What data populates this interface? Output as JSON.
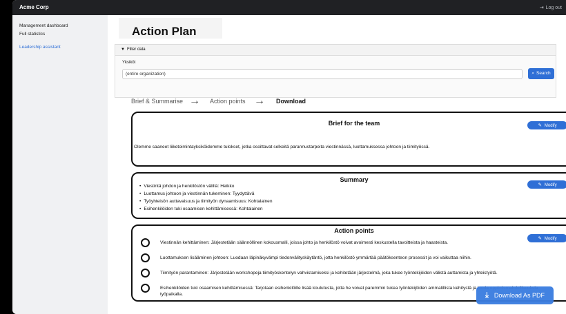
{
  "app": {
    "brand": "Acme Corp",
    "logout_label": "Log out"
  },
  "sidebar": {
    "items": [
      {
        "label": "Management dashboard"
      },
      {
        "label": "Full statistics"
      },
      {
        "label": "Leadership assistant",
        "active": true
      }
    ]
  },
  "page": {
    "title": "Action Plan"
  },
  "filter": {
    "header": "Filter data",
    "field_label": "Yksiköt",
    "value": "(entire organization)",
    "search_label": "Search"
  },
  "steps": [
    {
      "label": "Brief & Summarise"
    },
    {
      "label": "Action points"
    },
    {
      "label": "Download",
      "current": true
    }
  ],
  "brief": {
    "title": "Brief for the team",
    "modify_label": "Modify",
    "text": "Olemme saaneet liiketoimintayksiköidemme tulokset, jotka osoittavat selkeitä parannustarpeita viestinnässä, luottamuksessa johtoon ja tiimityössä."
  },
  "summary": {
    "title": "Summary",
    "modify_label": "Modify",
    "items": [
      "Viestintä johdon ja henkilöstön välillä: Heikko",
      "Luottamus johtoon ja viestinnän tukeminen: Tyydyttävä",
      "Työyhteisön auttavaisuus ja tiimityön dynaamisuus: Kohtalainen",
      "Esihenkilöiden tuki osaamisen kehittämisessä: Kohtalainen"
    ]
  },
  "action_points": {
    "title": "Action points",
    "modify_label": "Modify",
    "items": [
      "Viestinnän kehittäminen: Järjestetään säännöllinen kokousmalli, joissa johto ja henkilöstö voivat avoimesti keskustella tavoitteista ja haasteista.",
      "Luottamuksen lisääminen johtoon: Luodaan läpinäkyvämpi tiedonvälityskäytäntö, jotta henkilöstö ymmärtää päätöksenteon prosessit ja voi vaikuttaa niihin.",
      "Tiimityön parantaminen: Järjestetään workshopeja tiimityöskentelyn vahvistamiseksi ja kehitetään järjestelmä, joka tukee työntekijöiden välistä auttamista ja yhteistyötä.",
      "Esihenkilöiden tuki osaamisen kehittämisessä: Tarjotaan esihenkilöille lisää koulutusta, jotta he voivat paremmin tukea työntekijöiden ammatillista kehitystä ja luoda oppimismahdollisuuksia työpaikalla."
    ]
  },
  "download_label": "Download As PDF",
  "icons": {
    "logout": "logout-icon",
    "filter": "triangle-down-icon",
    "search": "search-icon",
    "modify": "pencil-icon",
    "step_arrow": "arrow-right-icon",
    "download": "download-icon"
  },
  "colors": {
    "accent": "#2f6fd6",
    "topbar": "#202124",
    "sidebar": "#f0f1f3"
  }
}
